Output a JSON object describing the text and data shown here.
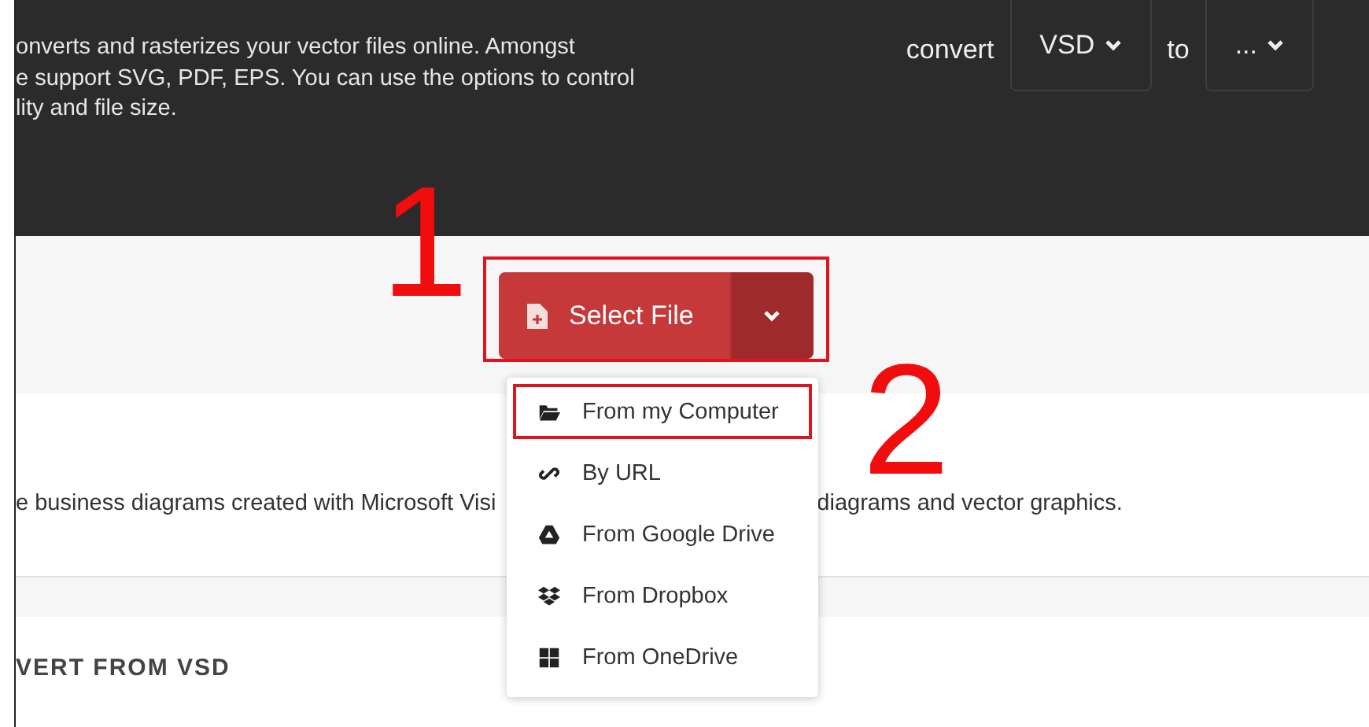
{
  "header": {
    "intro_lines": [
      "onverts and rasterizes your vector files online. Amongst",
      "e support SVG, PDF, EPS. You can use the options to control",
      "lity and file size."
    ],
    "convert_label": "convert",
    "from_format": "VSD",
    "to_label": "to",
    "to_format": "..."
  },
  "upload": {
    "button": "Select File",
    "menu_open": true,
    "menu": [
      {
        "kind": "computer",
        "label": "From my Computer",
        "highlighted": true
      },
      {
        "kind": "url",
        "label": "By URL",
        "highlighted": false
      },
      {
        "kind": "drive",
        "label": "From Google Drive",
        "highlighted": false
      },
      {
        "kind": "dropbox",
        "label": "From Dropbox",
        "highlighted": false
      },
      {
        "kind": "onedrive",
        "label": "From OneDrive",
        "highlighted": false
      }
    ]
  },
  "description": [
    "e business diagrams created with Microsoft Visi",
    "diagrams and vector graphics."
  ],
  "section_heading": "VERT FROM VSD",
  "annotations": [
    {
      "kind": "step",
      "label": "1"
    },
    {
      "kind": "step",
      "label": "2"
    }
  ]
}
